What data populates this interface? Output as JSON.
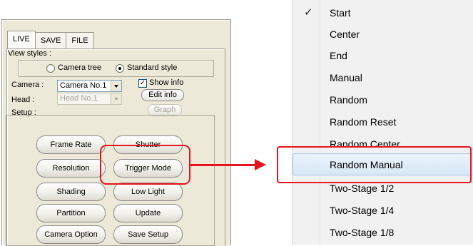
{
  "tabs": [
    {
      "label": "LIVE",
      "active": true
    },
    {
      "label": "SAVE",
      "active": false
    },
    {
      "label": "FILE",
      "active": false
    }
  ],
  "view_styles": {
    "label": "View styles :",
    "options": [
      {
        "label": "Camera tree",
        "selected": false
      },
      {
        "label": "Standard style",
        "selected": true
      }
    ]
  },
  "camera": {
    "label": "Camera :",
    "value": "Camera No.1"
  },
  "show_info": {
    "label": "Show info",
    "checked": true
  },
  "edit_info_label": "Edit info",
  "head": {
    "label": "Head :",
    "value": "Head No.1"
  },
  "graph_label": "Graph",
  "setup_label": "Setup :",
  "setup_buttons": [
    "Frame Rate",
    "Shutter",
    "Resolution",
    "Trigger Mode",
    "Shading",
    "Low Light",
    "Partition",
    "Update",
    "Camera Option",
    "Save Setup"
  ],
  "menu": {
    "items": [
      {
        "label": "Start",
        "checked": true
      },
      {
        "label": "Center"
      },
      {
        "label": "End"
      },
      {
        "label": "Manual"
      },
      {
        "label": "Random"
      },
      {
        "label": "Random Reset"
      },
      {
        "label": "Random Center"
      },
      {
        "label": "Random Manual",
        "highlighted": true
      },
      {
        "label": "Two-Stage 1/2"
      },
      {
        "label": "Two-Stage 1/4"
      },
      {
        "label": "Two-Stage 1/8"
      }
    ]
  },
  "colors": {
    "highlight": "#e8141d",
    "panel": "#ece9d8",
    "menu": "#f1f1f1"
  }
}
